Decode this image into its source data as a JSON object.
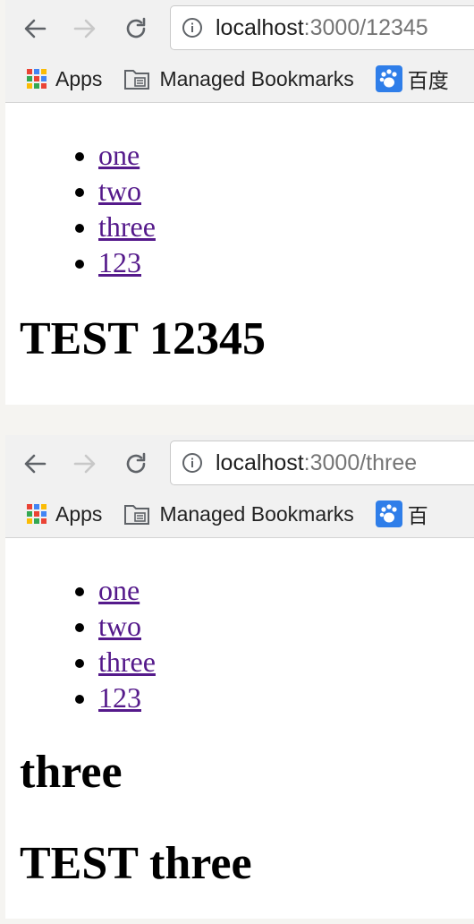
{
  "screenshots": [
    {
      "address": {
        "host": "localhost",
        "path": ":3000/12345"
      },
      "bookmarks": {
        "apps": "Apps",
        "managed": "Managed Bookmarks",
        "baidu": "百度"
      },
      "links": [
        "one",
        "two",
        "three",
        "123"
      ],
      "route_heading": "",
      "test_heading": "TEST 12345"
    },
    {
      "address": {
        "host": "localhost",
        "path": ":3000/three"
      },
      "bookmarks": {
        "apps": "Apps",
        "managed": "Managed Bookmarks",
        "baidu": "百"
      },
      "links": [
        "one",
        "two",
        "three",
        "123"
      ],
      "route_heading": "three",
      "test_heading": "TEST three"
    }
  ],
  "icons": {
    "back": "back-arrow-icon",
    "forward": "forward-arrow-icon",
    "reload": "reload-icon",
    "info": "info-icon",
    "apps": "apps-grid-icon",
    "folder": "folder-icon",
    "baidu": "baidu-paw-icon"
  },
  "colors": {
    "link_visited": "#551a8b",
    "toolbar_bg": "#f1f1f1",
    "url_path": "#757575",
    "forward_disabled": "#c8c8c8"
  }
}
